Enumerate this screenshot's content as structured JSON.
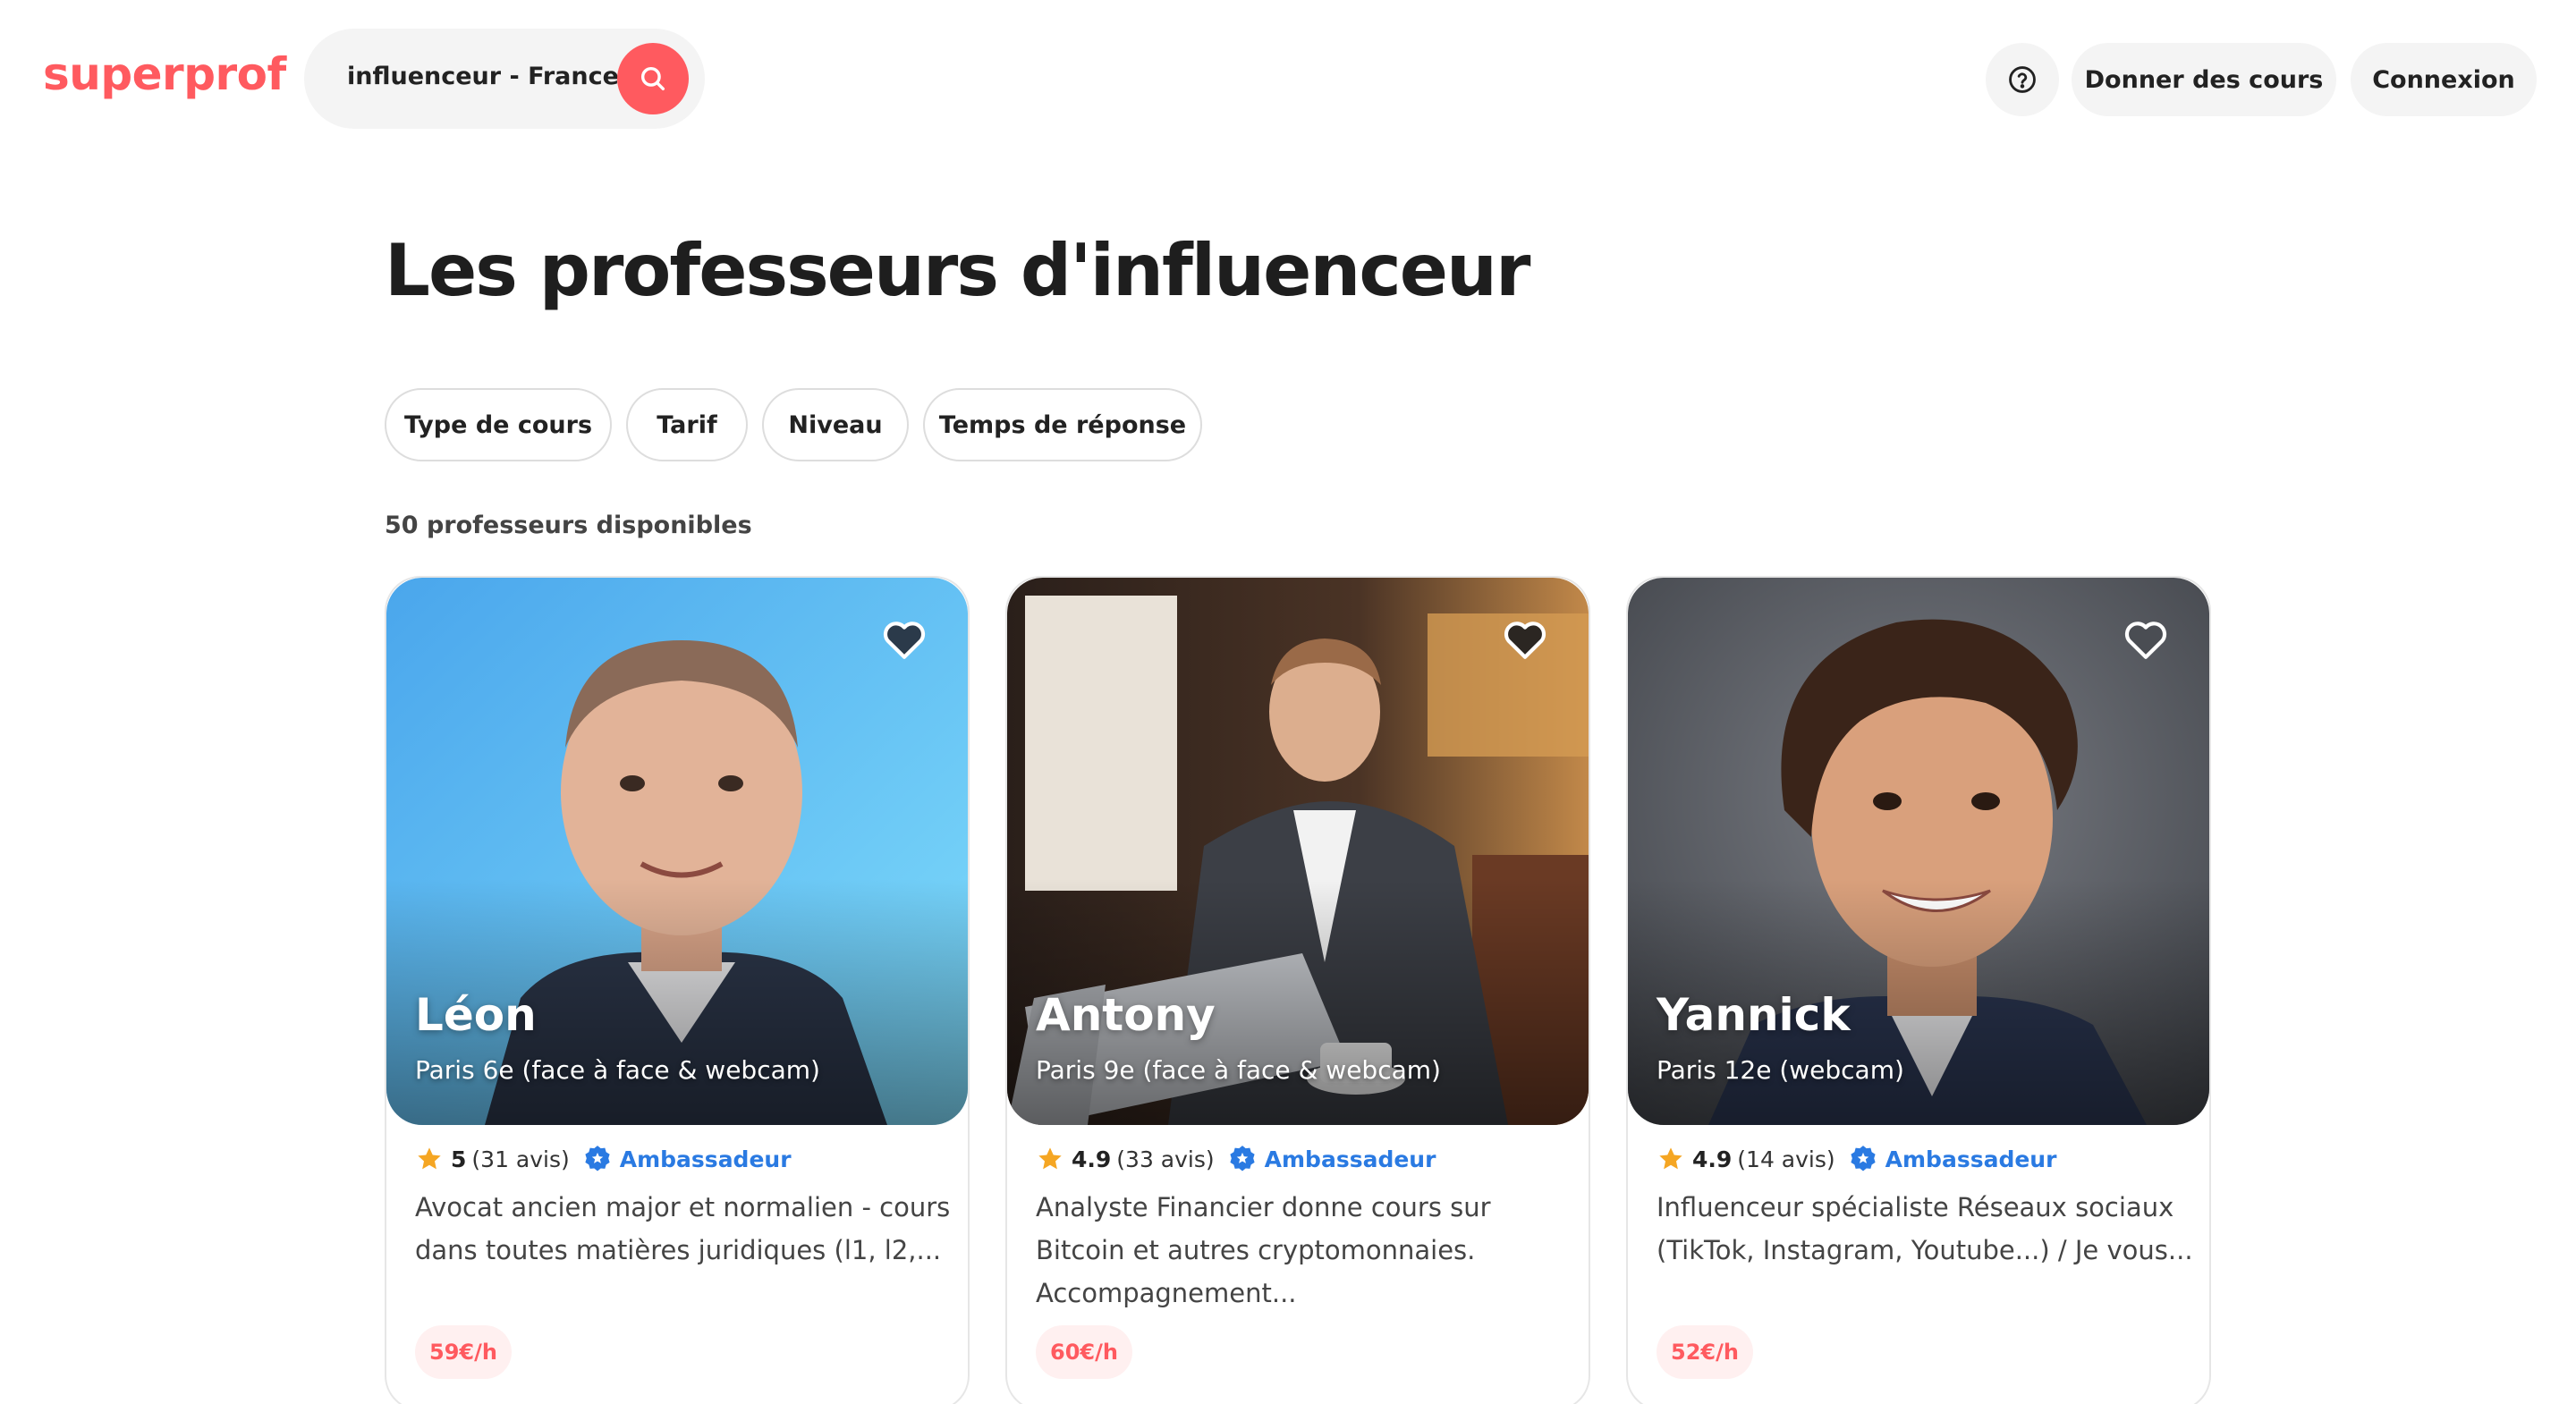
{
  "header": {
    "logo": "superprof",
    "search_value": "influenceur - France",
    "search_icon": "search-icon",
    "help_icon": "question-circle-icon",
    "give_lessons_label": "Donner des cours",
    "login_label": "Connexion"
  },
  "main": {
    "title": "Les professeurs d'influenceur",
    "filters": [
      "Type de cours",
      "Tarif",
      "Niveau",
      "Temps de réponse"
    ],
    "result_count": "50 professeurs disponibles"
  },
  "cards": [
    {
      "name": "Léon",
      "location": "Paris 6e (face à face & webcam)",
      "rating": "5",
      "reviews": "(31 avis)",
      "badge": "Ambassadeur",
      "description": "Avocat ancien major et normalien - cours dans toutes matières juridiques (l1, l2,...",
      "price": "59€/h",
      "photo_bg": "#5ab8f0"
    },
    {
      "name": "Antony",
      "location": "Paris 9e (face à face & webcam)",
      "rating": "4.9",
      "reviews": "(33 avis)",
      "badge": "Ambassadeur",
      "description": "Analyste Financier donne cours sur Bitcoin et autres cryptomonnaies. Accompagnement...",
      "price": "60€/h",
      "photo_bg": "#3a2a22"
    },
    {
      "name": "Yannick",
      "location": "Paris 12e (webcam)",
      "rating": "4.9",
      "reviews": "(14 avis)",
      "badge": "Ambassadeur",
      "description": "Influenceur spécialiste Réseaux sociaux (TikTok, Instagram, Youtube...) / Je vous...",
      "price": "52€/h",
      "photo_bg": "#5c5f66"
    }
  ],
  "colors": {
    "brand": "#ff5a5f",
    "ambassador": "#2a7ae2",
    "star": "#f5a623"
  }
}
